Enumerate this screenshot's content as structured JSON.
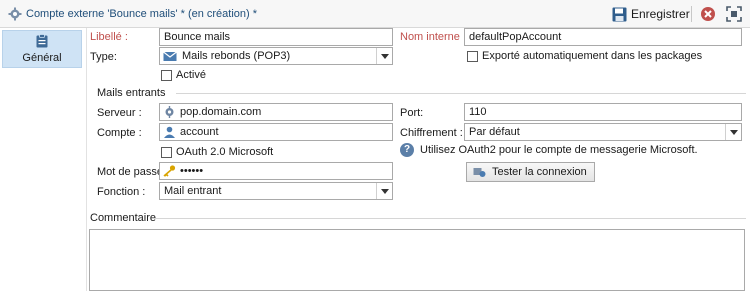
{
  "window": {
    "title": "Compte externe 'Bounce mails' * (en création) *",
    "save_label": "Enregistrer"
  },
  "sidebar": {
    "tabs": [
      {
        "label": "Général"
      }
    ]
  },
  "form": {
    "libelle": {
      "label": "Libellé :",
      "value": "Bounce mails"
    },
    "nom_interne": {
      "label": "Nom interne :",
      "value": "defaultPopAccount"
    },
    "type": {
      "label": "Type:",
      "value": "Mails rebonds (POP3)"
    },
    "active": {
      "label": "Activé",
      "checked": false
    },
    "exported": {
      "label": "Exporté automatiquement dans les packages",
      "checked": false
    }
  },
  "incoming": {
    "group_title": "Mails entrants",
    "serveur": {
      "label": "Serveur :",
      "value": "pop.domain.com"
    },
    "port": {
      "label": "Port:",
      "value": "110"
    },
    "compte": {
      "label": "Compte :",
      "value": "account"
    },
    "chiffrement": {
      "label": "Chiffrement :",
      "value": "Par défaut"
    },
    "oauth": {
      "label": "OAuth 2.0 Microsoft",
      "checked": false
    },
    "oauth_info": "Utilisez OAuth2 pour le compte de messagerie Microsoft.",
    "password": {
      "label": "Mot de passe :",
      "value": "••••••"
    },
    "test_button": "Tester la connexion",
    "fonction": {
      "label": "Fonction :",
      "value": "Mail entrant"
    }
  },
  "comment": {
    "label": "Commentaire",
    "value": ""
  },
  "colors": {
    "required_label": "#c0504d",
    "title_text": "#1f4e79",
    "tab_selected": "#cfe3f5"
  }
}
